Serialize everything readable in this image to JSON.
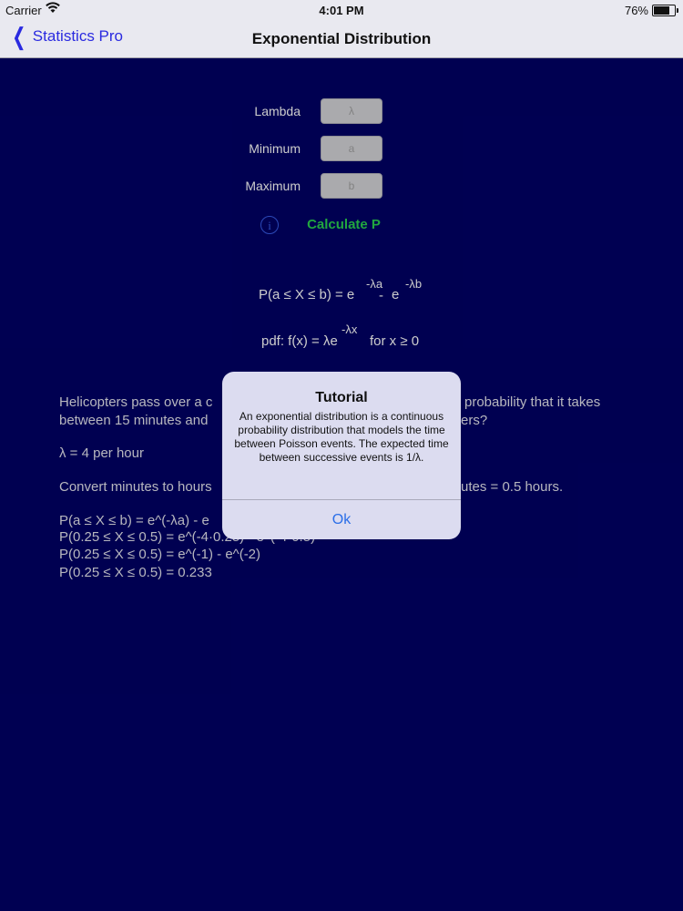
{
  "status_bar": {
    "carrier": "Carrier",
    "time": "4:01 PM",
    "battery": "76%",
    "battery_level": 0.76
  },
  "nav": {
    "back_label": "Statistics Pro",
    "title": "Exponential Distribution"
  },
  "form": {
    "lambda": {
      "label": "Lambda",
      "placeholder": "λ"
    },
    "minimum": {
      "label": "Minimum",
      "placeholder": "a"
    },
    "maximum": {
      "label": "Maximum",
      "placeholder": "b"
    },
    "calculate_label": "Calculate P",
    "info_glyph": "i"
  },
  "formulas": {
    "cdf_main": "P(a ≤ X ≤ b) = e",
    "cdf_exp1": "-λa",
    "cdf_minus": "-",
    "cdf_e2": "e",
    "cdf_exp2": "-λb",
    "pdf_main": "pdf:  f(x) = λe",
    "pdf_exp": "-λx",
    "pdf_cond": "for x ≥ 0"
  },
  "example": {
    "line1": "Helicopters pass over a c",
    "line1_tail": "probability that it takes",
    "line2": "between 15 minutes and",
    "line2_tail": "ers?",
    "lambda_line": "λ = 4 per hour",
    "convert_line": "Convert minutes to hours",
    "convert_tail": "utes = 0.5 hours.",
    "calc1": "P(a ≤ X ≤ b) = e^(-λa) - e",
    "calc2": "P(0.25 ≤ X ≤ 0.5) = e^(-4·0.25) - e^(-4·0.5)",
    "calc3": "P(0.25 ≤ X ≤ 0.5) = e^(-1) - e^(-2)",
    "calc4": "P(0.25 ≤ X ≤ 0.5) = 0.233"
  },
  "alert": {
    "title": "Tutorial",
    "message": "An exponential distribution is a continuous probability distribution that models the time between Poisson events. The expected time between successive events is 1/λ.",
    "ok_label": "Ok"
  }
}
